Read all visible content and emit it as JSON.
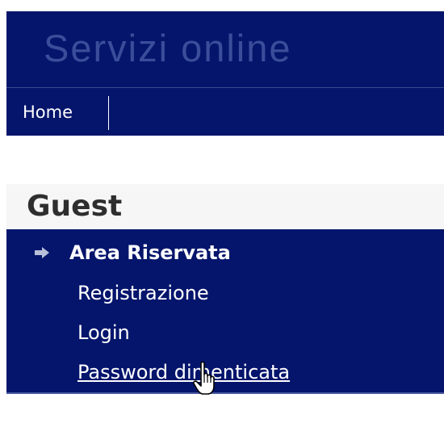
{
  "header": {
    "title": "Servizi online"
  },
  "nav": {
    "home_label": "Home"
  },
  "guest": {
    "title": "Guest"
  },
  "menu": {
    "heading": "Area Riservata",
    "heading_icon": "arrow-right-icon",
    "items": [
      {
        "label": "Registrazione"
      },
      {
        "label": "Login"
      },
      {
        "label": "Password dimenticata"
      }
    ]
  },
  "cursor": {
    "icon": "hand-pointer-icon"
  },
  "colors": {
    "banner_bg": "#05156c",
    "banner_text": "#3a4d9a",
    "menu_bg": "#05156c",
    "guest_bg": "#f6f6f6",
    "guest_text": "#2e2e2e",
    "link_text": "#ffffff"
  }
}
